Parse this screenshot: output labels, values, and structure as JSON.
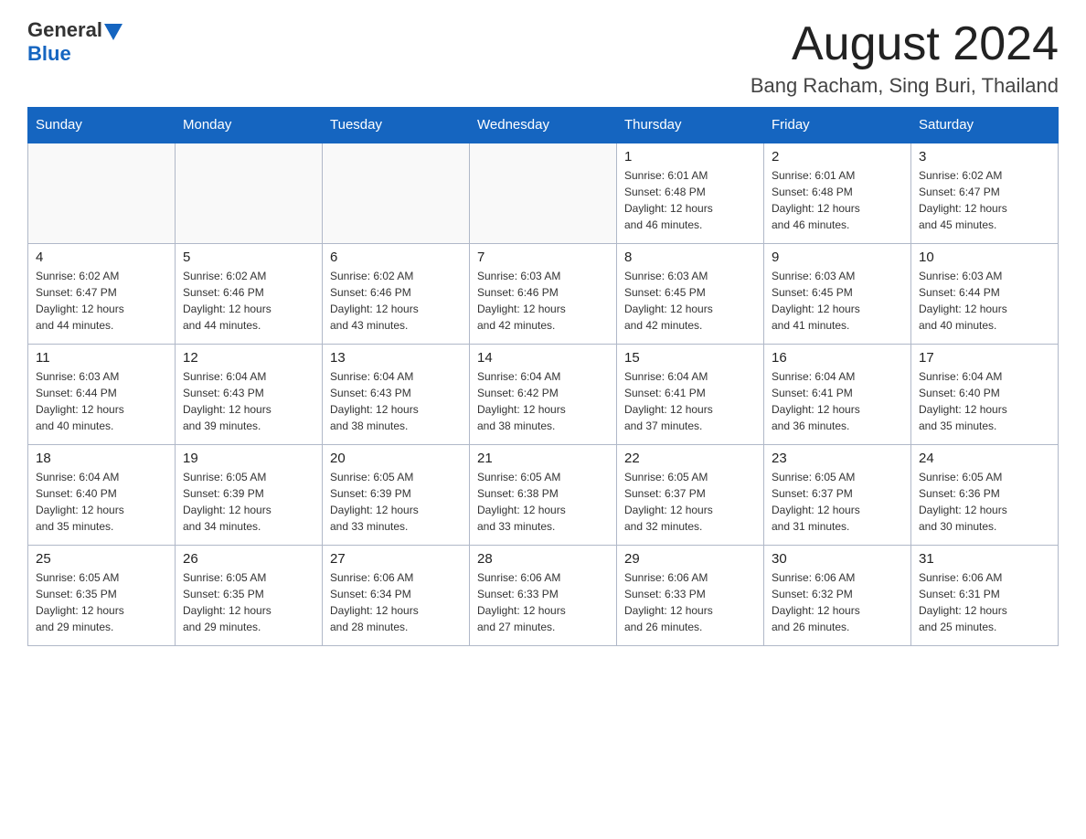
{
  "header": {
    "logo_general": "General",
    "logo_blue": "Blue",
    "month_title": "August 2024",
    "location": "Bang Racham, Sing Buri, Thailand"
  },
  "days_of_week": [
    "Sunday",
    "Monday",
    "Tuesday",
    "Wednesday",
    "Thursday",
    "Friday",
    "Saturday"
  ],
  "weeks": [
    [
      {
        "day": "",
        "info": ""
      },
      {
        "day": "",
        "info": ""
      },
      {
        "day": "",
        "info": ""
      },
      {
        "day": "",
        "info": ""
      },
      {
        "day": "1",
        "info": "Sunrise: 6:01 AM\nSunset: 6:48 PM\nDaylight: 12 hours\nand 46 minutes."
      },
      {
        "day": "2",
        "info": "Sunrise: 6:01 AM\nSunset: 6:48 PM\nDaylight: 12 hours\nand 46 minutes."
      },
      {
        "day": "3",
        "info": "Sunrise: 6:02 AM\nSunset: 6:47 PM\nDaylight: 12 hours\nand 45 minutes."
      }
    ],
    [
      {
        "day": "4",
        "info": "Sunrise: 6:02 AM\nSunset: 6:47 PM\nDaylight: 12 hours\nand 44 minutes."
      },
      {
        "day": "5",
        "info": "Sunrise: 6:02 AM\nSunset: 6:46 PM\nDaylight: 12 hours\nand 44 minutes."
      },
      {
        "day": "6",
        "info": "Sunrise: 6:02 AM\nSunset: 6:46 PM\nDaylight: 12 hours\nand 43 minutes."
      },
      {
        "day": "7",
        "info": "Sunrise: 6:03 AM\nSunset: 6:46 PM\nDaylight: 12 hours\nand 42 minutes."
      },
      {
        "day": "8",
        "info": "Sunrise: 6:03 AM\nSunset: 6:45 PM\nDaylight: 12 hours\nand 42 minutes."
      },
      {
        "day": "9",
        "info": "Sunrise: 6:03 AM\nSunset: 6:45 PM\nDaylight: 12 hours\nand 41 minutes."
      },
      {
        "day": "10",
        "info": "Sunrise: 6:03 AM\nSunset: 6:44 PM\nDaylight: 12 hours\nand 40 minutes."
      }
    ],
    [
      {
        "day": "11",
        "info": "Sunrise: 6:03 AM\nSunset: 6:44 PM\nDaylight: 12 hours\nand 40 minutes."
      },
      {
        "day": "12",
        "info": "Sunrise: 6:04 AM\nSunset: 6:43 PM\nDaylight: 12 hours\nand 39 minutes."
      },
      {
        "day": "13",
        "info": "Sunrise: 6:04 AM\nSunset: 6:43 PM\nDaylight: 12 hours\nand 38 minutes."
      },
      {
        "day": "14",
        "info": "Sunrise: 6:04 AM\nSunset: 6:42 PM\nDaylight: 12 hours\nand 38 minutes."
      },
      {
        "day": "15",
        "info": "Sunrise: 6:04 AM\nSunset: 6:41 PM\nDaylight: 12 hours\nand 37 minutes."
      },
      {
        "day": "16",
        "info": "Sunrise: 6:04 AM\nSunset: 6:41 PM\nDaylight: 12 hours\nand 36 minutes."
      },
      {
        "day": "17",
        "info": "Sunrise: 6:04 AM\nSunset: 6:40 PM\nDaylight: 12 hours\nand 35 minutes."
      }
    ],
    [
      {
        "day": "18",
        "info": "Sunrise: 6:04 AM\nSunset: 6:40 PM\nDaylight: 12 hours\nand 35 minutes."
      },
      {
        "day": "19",
        "info": "Sunrise: 6:05 AM\nSunset: 6:39 PM\nDaylight: 12 hours\nand 34 minutes."
      },
      {
        "day": "20",
        "info": "Sunrise: 6:05 AM\nSunset: 6:39 PM\nDaylight: 12 hours\nand 33 minutes."
      },
      {
        "day": "21",
        "info": "Sunrise: 6:05 AM\nSunset: 6:38 PM\nDaylight: 12 hours\nand 33 minutes."
      },
      {
        "day": "22",
        "info": "Sunrise: 6:05 AM\nSunset: 6:37 PM\nDaylight: 12 hours\nand 32 minutes."
      },
      {
        "day": "23",
        "info": "Sunrise: 6:05 AM\nSunset: 6:37 PM\nDaylight: 12 hours\nand 31 minutes."
      },
      {
        "day": "24",
        "info": "Sunrise: 6:05 AM\nSunset: 6:36 PM\nDaylight: 12 hours\nand 30 minutes."
      }
    ],
    [
      {
        "day": "25",
        "info": "Sunrise: 6:05 AM\nSunset: 6:35 PM\nDaylight: 12 hours\nand 29 minutes."
      },
      {
        "day": "26",
        "info": "Sunrise: 6:05 AM\nSunset: 6:35 PM\nDaylight: 12 hours\nand 29 minutes."
      },
      {
        "day": "27",
        "info": "Sunrise: 6:06 AM\nSunset: 6:34 PM\nDaylight: 12 hours\nand 28 minutes."
      },
      {
        "day": "28",
        "info": "Sunrise: 6:06 AM\nSunset: 6:33 PM\nDaylight: 12 hours\nand 27 minutes."
      },
      {
        "day": "29",
        "info": "Sunrise: 6:06 AM\nSunset: 6:33 PM\nDaylight: 12 hours\nand 26 minutes."
      },
      {
        "day": "30",
        "info": "Sunrise: 6:06 AM\nSunset: 6:32 PM\nDaylight: 12 hours\nand 26 minutes."
      },
      {
        "day": "31",
        "info": "Sunrise: 6:06 AM\nSunset: 6:31 PM\nDaylight: 12 hours\nand 25 minutes."
      }
    ]
  ]
}
